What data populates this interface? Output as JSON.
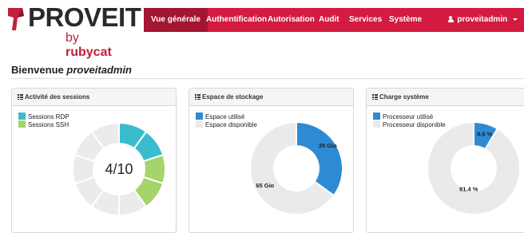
{
  "brand": {
    "name": "PROVEIT",
    "by": "by",
    "company": "rubycat",
    "colors": {
      "primary": "#d31b3f",
      "active": "#a31530",
      "dark": "#2a2a2a"
    }
  },
  "nav": {
    "items": [
      {
        "label": "Vue générale",
        "active": true
      },
      {
        "label": "Authentification",
        "active": false
      },
      {
        "label": "Autorisation",
        "active": false
      },
      {
        "label": "Audit",
        "active": false
      },
      {
        "label": "Services",
        "active": false
      },
      {
        "label": "Système",
        "active": false
      }
    ],
    "user": {
      "label": "proveitadmin",
      "icon": "user-icon",
      "dropdown_icon": "caret-down-icon"
    }
  },
  "page": {
    "welcome": "Bienvenue",
    "username": "proveitadmin"
  },
  "panels": {
    "sessions": {
      "title": "Activité des sessions",
      "icon": "list-icon",
      "legend": [
        {
          "label": "Sessions RDP",
          "color": "#3bbccc"
        },
        {
          "label": "Sessions SSH",
          "color": "#a5d46a"
        }
      ],
      "center_text": "4/10"
    },
    "storage": {
      "title": "Espace de stockage",
      "icon": "list-icon",
      "legend": [
        {
          "label": "Espace utilisé",
          "color": "#2e8bd3"
        },
        {
          "label": "Espace disponible",
          "color": "#eaeaea"
        }
      ]
    },
    "cpu": {
      "title": "Charge système",
      "icon": "list-icon",
      "legend": [
        {
          "label": "Processeur utilisé",
          "color": "#2e8bd3"
        },
        {
          "label": "Processeur disponible",
          "color": "#eaeaea"
        }
      ]
    }
  },
  "chart_data": [
    {
      "type": "pie",
      "variant": "segmented-donut",
      "total_segments": 10,
      "series": [
        {
          "name": "Sessions RDP",
          "value": 2,
          "color": "#3bbccc"
        },
        {
          "name": "Sessions SSH",
          "value": 2,
          "color": "#a5d46a"
        },
        {
          "value": 6,
          "color": "#ebebeb"
        }
      ],
      "center_label": "4/10"
    },
    {
      "type": "pie",
      "variant": "donut",
      "series": [
        {
          "name": "Espace utilisé",
          "value": 35,
          "label": "35 Gio",
          "color": "#2e8bd3"
        },
        {
          "name": "Espace disponible",
          "value": 65,
          "label": "65 Gio",
          "color": "#eaeaea"
        }
      ]
    },
    {
      "type": "pie",
      "variant": "donut",
      "series": [
        {
          "name": "Processeur utilisé",
          "value": 8.6,
          "label": "8.6 %",
          "color": "#2e8bd3"
        },
        {
          "name": "Processeur disponible",
          "value": 91.4,
          "label": "91.4 %",
          "color": "#eaeaea"
        }
      ]
    }
  ]
}
